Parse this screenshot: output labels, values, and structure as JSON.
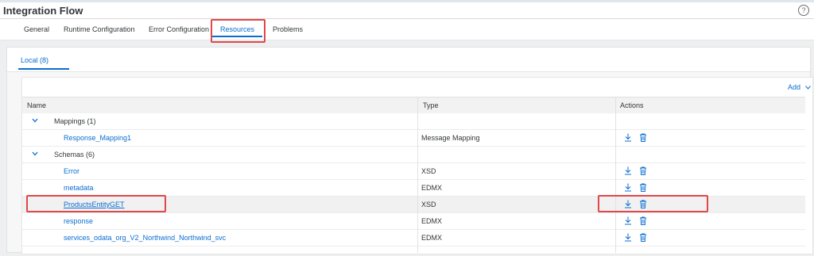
{
  "header": {
    "title": "Integration Flow",
    "help_icon": "?"
  },
  "tabs": [
    {
      "label": "General",
      "active": false
    },
    {
      "label": "Runtime Configuration",
      "active": false
    },
    {
      "label": "Error Configuration",
      "active": false
    },
    {
      "label": "Resources",
      "active": true
    },
    {
      "label": "Problems",
      "active": false
    }
  ],
  "subtab": {
    "label": "Local (8)"
  },
  "table": {
    "add_label": "Add",
    "columns": {
      "name": "Name",
      "type": "Type",
      "actions": "Actions"
    },
    "rows": [
      {
        "kind": "group",
        "name": "Mappings (1)",
        "type": ""
      },
      {
        "kind": "item",
        "name": "Response_Mapping1",
        "type": "Message Mapping"
      },
      {
        "kind": "group",
        "name": "Schemas (6)",
        "type": ""
      },
      {
        "kind": "item",
        "name": "Error",
        "type": "XSD"
      },
      {
        "kind": "item",
        "name": "metadata",
        "type": "EDMX"
      },
      {
        "kind": "item",
        "name": "ProductsEntityGET",
        "type": "XSD"
      },
      {
        "kind": "item",
        "name": "response",
        "type": "EDMX"
      },
      {
        "kind": "item",
        "name": "services_odata_org_V2_Northwind_Northwind_svc",
        "type": "EDMX"
      }
    ]
  },
  "icons": {
    "download": "download-icon",
    "delete": "trash-icon",
    "expand": "chevron-down-icon",
    "help": "help-icon"
  },
  "colors": {
    "accent": "#0a6ed1",
    "highlight": "#e0484a",
    "text": "#32363a"
  }
}
